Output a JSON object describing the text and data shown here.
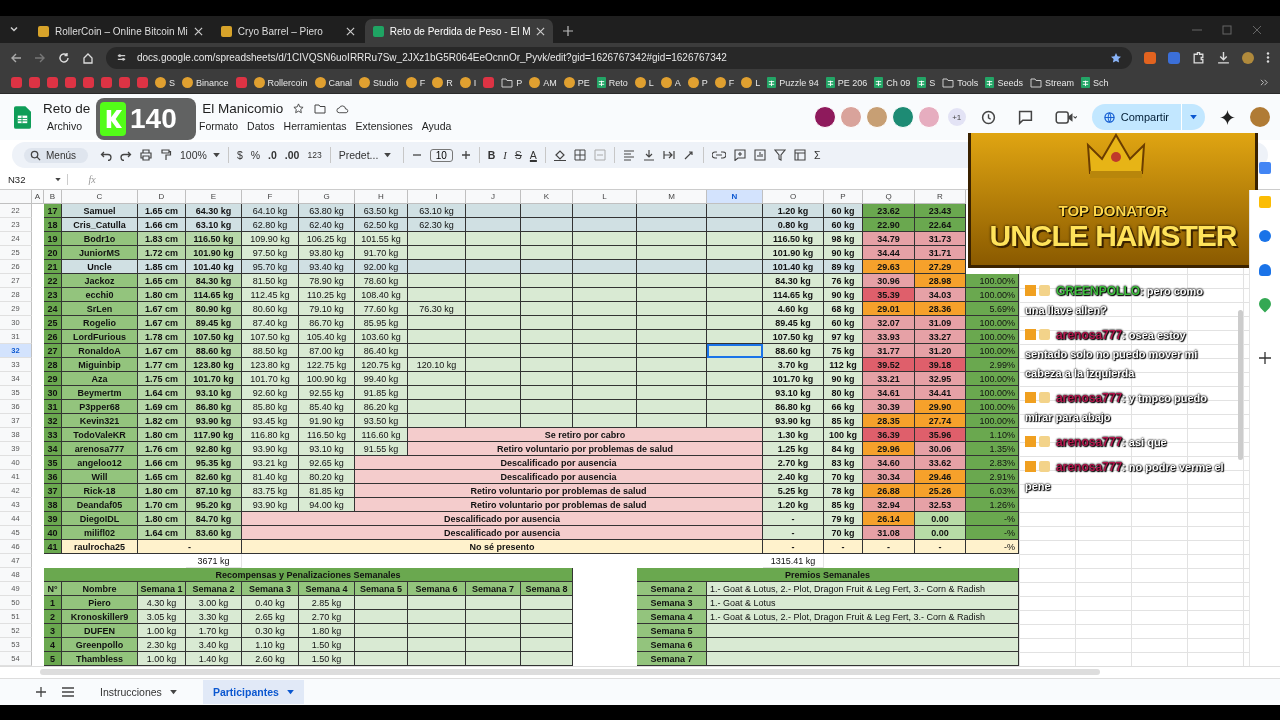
{
  "browser": {
    "tabs": [
      {
        "title": "RollerCoin – Online Bitcoin Mi",
        "selected": false
      },
      {
        "title": "Cryo Barrel – Piero",
        "selected": false
      },
      {
        "title": "Reto de Perdida de Peso - El M",
        "selected": true
      }
    ],
    "url": "docs.google.com/spreadsheets/d/1CIVQSN6uoIRRRu7Sw_2JXz1bG5R064EeOcnnOr_Pyvk/edit?gid=1626767342#gid=1626767342",
    "bookmarks": [
      {
        "kind": "icon"
      },
      {
        "kind": "icon"
      },
      {
        "kind": "icon"
      },
      {
        "kind": "icon"
      },
      {
        "kind": "icon"
      },
      {
        "kind": "icon"
      },
      {
        "kind": "icon"
      },
      {
        "kind": "icon"
      },
      {
        "kind": "site",
        "label": "S"
      },
      {
        "kind": "site",
        "label": "Binance"
      },
      {
        "kind": "icon"
      },
      {
        "kind": "site",
        "label": "Rollercoin"
      },
      {
        "kind": "site",
        "label": "Canal"
      },
      {
        "kind": "site",
        "label": "Studio"
      },
      {
        "kind": "site",
        "label": "F"
      },
      {
        "kind": "site",
        "label": "R"
      },
      {
        "kind": "site",
        "label": "I"
      },
      {
        "kind": "icon"
      },
      {
        "kind": "folder",
        "label": "P"
      },
      {
        "kind": "site",
        "label": "AM"
      },
      {
        "kind": "site",
        "label": "PE"
      },
      {
        "kind": "sheet",
        "label": "Reto"
      },
      {
        "kind": "site",
        "label": "L"
      },
      {
        "kind": "site",
        "label": "A"
      },
      {
        "kind": "site",
        "label": "P"
      },
      {
        "kind": "site",
        "label": "F"
      },
      {
        "kind": "site",
        "label": "L"
      },
      {
        "kind": "sheet",
        "label": "Puzzle 94"
      },
      {
        "kind": "sheet",
        "label": "PE 206"
      },
      {
        "kind": "sheet",
        "label": "Ch 09"
      },
      {
        "kind": "sheet",
        "label": "S"
      },
      {
        "kind": "folder",
        "label": "Tools"
      },
      {
        "kind": "sheet",
        "label": "Seeds"
      },
      {
        "kind": "folder",
        "label": "Stream"
      },
      {
        "kind": "sheet",
        "label": "Sch"
      }
    ]
  },
  "doc": {
    "title_parts": [
      "Reto de",
      "El Manicomio"
    ],
    "menus": [
      "Archivo",
      "Formato",
      "Datos",
      "Herramientas",
      "Extensiones",
      "Ayuda"
    ],
    "collaborators": [
      {
        "color": "#8e1a5c"
      },
      {
        "color": "#d9a39b"
      },
      {
        "color": "#c79f74"
      },
      {
        "color": "#1d8b74"
      },
      {
        "color": "#e6adbf"
      }
    ],
    "more_collaborators": "+1",
    "share": "Compartir"
  },
  "overlay_badge": {
    "count": "140"
  },
  "toolbar": {
    "search": "Menús",
    "zoom": "100%",
    "number_formats": [
      "$",
      "%",
      ".0",
      ".00",
      "123"
    ],
    "font": "Predet...",
    "font_size": "10",
    "styles": [
      {
        "label": "B",
        "kind": "bold"
      },
      {
        "label": "I",
        "kind": "italic"
      },
      {
        "label": "S",
        "kind": "strike"
      },
      {
        "label": "A",
        "kind": "color"
      }
    ],
    "functions": "Σ"
  },
  "formula_bar": {
    "cell": "N32",
    "label": "fx"
  },
  "sheet": {
    "columns": [
      {
        "label": "A",
        "selected": false
      },
      {
        "label": "B",
        "selected": false
      },
      {
        "label": "C",
        "selected": false
      },
      {
        "label": "D",
        "selected": false
      },
      {
        "label": "E",
        "selected": false
      },
      {
        "label": "F",
        "selected": false
      },
      {
        "label": "G",
        "selected": false
      },
      {
        "label": "H",
        "selected": false
      },
      {
        "label": "I",
        "selected": false
      },
      {
        "label": "J",
        "selected": false
      },
      {
        "label": "K",
        "selected": false
      },
      {
        "label": "L",
        "selected": false
      },
      {
        "label": "M",
        "selected": false
      },
      {
        "label": "N",
        "selected": true
      },
      {
        "label": "O",
        "selected": false
      },
      {
        "label": "P",
        "selected": false
      },
      {
        "label": "Q",
        "selected": false
      },
      {
        "label": "R",
        "selected": false
      }
    ],
    "rows": [
      {
        "row": "22",
        "selected": false,
        "kind": "highlight",
        "n": "17",
        "name": "Samuel",
        "height": "1.65 cm",
        "initial": "64.30 kg",
        "weights": [
          "64.10 kg",
          "63.80 kg",
          "63.50 kg",
          "63.10 kg"
        ],
        "loss": "1.20 kg",
        "target": "60 kg",
        "q": {
          "value": "23.62",
          "color": "#6aa84f"
        },
        "r": {
          "value": "23.43",
          "color": "#6aa84f"
        }
      },
      {
        "row": "23",
        "selected": false,
        "kind": "highlight",
        "n": "18",
        "name": "Cris_Catulla",
        "height": "1.66 cm",
        "initial": "63.10 kg",
        "weights": [
          "62.80 kg",
          "62.40 kg",
          "62.50 kg",
          "62.30 kg"
        ],
        "loss": "0.80 kg",
        "target": "60 kg",
        "q": {
          "value": "22.90",
          "color": "#6aa84f"
        },
        "r": {
          "value": "22.64",
          "color": "#6aa84f"
        }
      },
      {
        "row": "24",
        "selected": false,
        "kind": "normal",
        "n": "19",
        "name": "Bodr1o",
        "height": "1.83 cm",
        "initial": "116.50 kg",
        "weights": [
          "109.90 kg",
          "106.25 kg",
          "101.55 kg"
        ],
        "loss": "116.50 kg",
        "target": "98 kg",
        "q": {
          "value": "34.79",
          "color": "#e6a1a6"
        },
        "r": {
          "value": "31.73",
          "color": "#e6a1a6"
        }
      },
      {
        "row": "25",
        "selected": false,
        "kind": "normal",
        "n": "20",
        "name": "JuniorMS",
        "height": "1.72 cm",
        "initial": "101.90 kg",
        "weights": [
          "97.50 kg",
          "93.80 kg",
          "91.70 kg"
        ],
        "loss": "101.90 kg",
        "target": "90 kg",
        "q": {
          "value": "34.44",
          "color": "#e6a1a6"
        },
        "r": {
          "value": "31.71",
          "color": "#e6a1a6"
        }
      },
      {
        "row": "26",
        "selected": false,
        "kind": "highlight",
        "n": "21",
        "name": "Uncle",
        "height": "1.85 cm",
        "initial": "101.40 kg",
        "weights": [
          "95.70 kg",
          "93.40 kg",
          "92.00 kg"
        ],
        "loss": "101.40 kg",
        "target": "89 kg",
        "q": {
          "value": "29.63",
          "color": "#f6a12b"
        },
        "r": {
          "value": "27.29",
          "color": "#f6a12b"
        }
      },
      {
        "row": "27",
        "selected": false,
        "kind": "normal",
        "n": "22",
        "name": "Jackoz",
        "height": "1.65 cm",
        "initial": "84.30 kg",
        "weights": [
          "81.50 kg",
          "78.90 kg",
          "78.60 kg"
        ],
        "loss": "84.30 kg",
        "target": "76 kg",
        "q": {
          "value": "30.96",
          "color": "#e6a1a6"
        },
        "r": {
          "value": "28.98",
          "color": "#f6a12b"
        },
        "pct": "100.00%"
      },
      {
        "row": "28",
        "selected": false,
        "kind": "normal",
        "n": "23",
        "name": "ecchi0",
        "height": "1.80 cm",
        "initial": "114.65 kg",
        "weights": [
          "112.45 kg",
          "110.25 kg",
          "108.40 kg"
        ],
        "loss": "114.65 kg",
        "target": "90 kg",
        "q": {
          "value": "35.39",
          "color": "#df5f6b"
        },
        "r": {
          "value": "34.03",
          "color": "#e6a1a6"
        },
        "pct": "100.00%"
      },
      {
        "row": "29",
        "selected": false,
        "kind": "normal",
        "n": "24",
        "name": "SrLen",
        "height": "1.67 cm",
        "initial": "80.90 kg",
        "weights": [
          "80.60 kg",
          "79.10 kg",
          "77.60 kg",
          "76.30 kg"
        ],
        "loss": "4.60 kg",
        "target": "68 kg",
        "q": {
          "value": "29.01",
          "color": "#f6a12b"
        },
        "r": {
          "value": "28.36",
          "color": "#f6a12b"
        },
        "pct": "5.69%"
      },
      {
        "row": "30",
        "selected": false,
        "kind": "normal",
        "n": "25",
        "name": "Rogelio",
        "height": "1.67 cm",
        "initial": "89.45 kg",
        "weights": [
          "87.40 kg",
          "86.70 kg",
          "85.95 kg"
        ],
        "loss": "89.45 kg",
        "target": "60 kg",
        "q": {
          "value": "32.07",
          "color": "#e6a1a6"
        },
        "r": {
          "value": "31.09",
          "color": "#e6a1a6"
        },
        "pct": "100.00%"
      },
      {
        "row": "31",
        "selected": false,
        "kind": "normal",
        "n": "26",
        "name": "LordFurious",
        "height": "1.78 cm",
        "initial": "107.50 kg",
        "weights": [
          "107.50 kg",
          "105.40 kg",
          "103.60 kg"
        ],
        "loss": "107.50 kg",
        "target": "97 kg",
        "q": {
          "value": "33.93",
          "color": "#e6a1a6"
        },
        "r": {
          "value": "33.27",
          "color": "#e6a1a6"
        },
        "pct": "100.00%"
      },
      {
        "row": "32",
        "selected": true,
        "kind": "normal",
        "n": "27",
        "name": "RonaldoA",
        "height": "1.67 cm",
        "initial": "88.60 kg",
        "weights": [
          "88.50 kg",
          "87.00 kg",
          "86.40 kg"
        ],
        "loss": "88.60 kg",
        "target": "75 kg",
        "q": {
          "value": "31.77",
          "color": "#e6a1a6"
        },
        "r": {
          "value": "31.20",
          "color": "#e6a1a6"
        },
        "pct": "100.00%"
      },
      {
        "row": "33",
        "selected": false,
        "kind": "normal",
        "n": "28",
        "name": "Miguinbip",
        "height": "1.77 cm",
        "initial": "123.80 kg",
        "weights": [
          "123.80 kg",
          "122.75 kg",
          "120.75 kg",
          "120.10 kg"
        ],
        "loss": "3.70 kg",
        "target": "112 kg",
        "q": {
          "value": "39.52",
          "color": "#df5f6b"
        },
        "r": {
          "value": "39.18",
          "color": "#df5f6b"
        },
        "pct": "2.99%"
      },
      {
        "row": "34",
        "selected": false,
        "kind": "normal",
        "n": "29",
        "name": "Aza",
        "height": "1.75 cm",
        "initial": "101.70 kg",
        "weights": [
          "101.70 kg",
          "100.90 kg",
          "99.40 kg"
        ],
        "loss": "101.70 kg",
        "target": "90 kg",
        "q": {
          "value": "33.21",
          "color": "#e6a1a6"
        },
        "r": {
          "value": "32.95",
          "color": "#e6a1a6"
        },
        "pct": "100.00%"
      },
      {
        "row": "35",
        "selected": false,
        "kind": "normal",
        "n": "30",
        "name": "Beymertm",
        "height": "1.64 cm",
        "initial": "93.10 kg",
        "weights": [
          "92.60 kg",
          "92.55 kg",
          "91.85 kg"
        ],
        "loss": "93.10 kg",
        "target": "80 kg",
        "q": {
          "value": "34.61",
          "color": "#e6a1a6"
        },
        "r": {
          "value": "34.41",
          "color": "#e6a1a6"
        },
        "pct": "100.00%"
      },
      {
        "row": "36",
        "selected": false,
        "kind": "normal",
        "n": "31",
        "name": "P3pper68",
        "height": "1.69 cm",
        "initial": "86.80 kg",
        "weights": [
          "85.80 kg",
          "85.40 kg",
          "86.20 kg"
        ],
        "loss": "86.80 kg",
        "target": "66 kg",
        "q": {
          "value": "30.39",
          "color": "#e6a1a6"
        },
        "r": {
          "value": "29.90",
          "color": "#f6a12b"
        },
        "pct": "100.00%"
      },
      {
        "row": "37",
        "selected": false,
        "kind": "normal",
        "n": "32",
        "name": "Kevin321",
        "height": "1.82 cm",
        "initial": "93.90 kg",
        "weights": [
          "93.45 kg",
          "91.90 kg",
          "93.50 kg"
        ],
        "loss": "93.90 kg",
        "target": "85 kg",
        "q": {
          "value": "28.35",
          "color": "#f6a12b"
        },
        "r": {
          "value": "27.74",
          "color": "#f6a12b"
        },
        "pct": "100.00%"
      },
      {
        "row": "38",
        "selected": false,
        "kind": "normal",
        "n": "33",
        "name": "TodoValeKR",
        "height": "1.80 cm",
        "initial": "117.90 kg",
        "weights": [
          "116.80 kg",
          "116.50 kg",
          "116.60 kg"
        ],
        "status": "Se retiro por cabro",
        "loss": "1.30 kg",
        "target": "100 kg",
        "q": {
          "value": "36.39",
          "color": "#df5f6b"
        },
        "r": {
          "value": "35.96",
          "color": "#df5f6b"
        },
        "pct": "1.10%"
      },
      {
        "row": "39",
        "selected": false,
        "kind": "normal",
        "n": "34",
        "name": "arenosa777",
        "height": "1.76 cm",
        "initial": "92.80 kg",
        "weights": [
          "93.90 kg",
          "93.10 kg",
          "91.55 kg"
        ],
        "status": "Retiro voluntario por problemas de salud",
        "loss": "1.25 kg",
        "target": "84 kg",
        "q": {
          "value": "29.96",
          "color": "#f6a12b"
        },
        "r": {
          "value": "30.06",
          "color": "#e6a1a6"
        },
        "pct": "1.35%"
      },
      {
        "row": "40",
        "selected": false,
        "kind": "normal",
        "n": "35",
        "name": "angeloo12",
        "height": "1.66 cm",
        "initial": "95.35 kg",
        "weights": [
          "93.21 kg",
          "92.65 kg"
        ],
        "status": "Descalificado por ausencia",
        "loss": "2.70 kg",
        "target": "83 kg",
        "q": {
          "value": "34.60",
          "color": "#e6a1a6"
        },
        "r": {
          "value": "33.62",
          "color": "#e6a1a6"
        },
        "pct": "2.83%"
      },
      {
        "row": "41",
        "selected": false,
        "kind": "normal",
        "n": "36",
        "name": "Will",
        "height": "1.65 cm",
        "initial": "82.60 kg",
        "weights": [
          "81.40 kg",
          "80.20 kg"
        ],
        "status": "Descalificado por ausencia",
        "loss": "2.40 kg",
        "target": "70 kg",
        "q": {
          "value": "30.34",
          "color": "#e6a1a6"
        },
        "r": {
          "value": "29.46",
          "color": "#f6a12b"
        },
        "pct": "2.91%"
      },
      {
        "row": "42",
        "selected": false,
        "kind": "normal",
        "n": "37",
        "name": "Rick-18",
        "height": "1.80 cm",
        "initial": "87.10 kg",
        "weights": [
          "83.75 kg",
          "81.85 kg"
        ],
        "status": "Retiro voluntario por problemas de salud",
        "loss": "5.25 kg",
        "target": "78 kg",
        "q": {
          "value": "26.88",
          "color": "#f6a12b"
        },
        "r": {
          "value": "25.26",
          "color": "#f6a12b"
        },
        "pct": "6.03%"
      },
      {
        "row": "43",
        "selected": false,
        "kind": "normal",
        "n": "38",
        "name": "Deandaf05",
        "height": "1.70 cm",
        "initial": "95.20 kg",
        "weights": [
          "93.90 kg",
          "94.00 kg"
        ],
        "status": "Retiro voluntario por problemas de salud",
        "loss": "1.20 kg",
        "target": "85 kg",
        "q": {
          "value": "32.94",
          "color": "#e6a1a6"
        },
        "r": {
          "value": "32.53",
          "color": "#e6a1a6"
        },
        "pct": "1.26%"
      },
      {
        "row": "44",
        "selected": false,
        "kind": "normal",
        "n": "39",
        "name": "DiegoIDL",
        "height": "1.80 cm",
        "initial": "84.70 kg",
        "weights": [],
        "status": "Descalificado por ausencia",
        "loss": "-",
        "target": "79 kg",
        "q": {
          "value": "26.14",
          "color": "#f6a12b"
        },
        "r": {
          "value": "0.00",
          "color": "#b7dba6"
        },
        "pct": "-%"
      },
      {
        "row": "45",
        "selected": false,
        "kind": "normal",
        "n": "40",
        "name": "milifl02",
        "height": "1.64 cm",
        "initial": "83.60 kg",
        "weights": [],
        "status": "Descalificado por ausencia",
        "loss": "-",
        "target": "70 kg",
        "q": {
          "value": "31.08",
          "color": "#e6a1a6"
        },
        "r": {
          "value": "0.00",
          "color": "#b7dba6"
        },
        "pct": "-%"
      },
      {
        "row": "46",
        "selected": false,
        "kind": "absent",
        "n": "41",
        "name": "raulrocha25",
        "height": "-",
        "weights": [],
        "status": "No sé presento",
        "loss": "-",
        "target": "-",
        "q": {
          "value": "-",
          "color": "#fff2cc"
        },
        "r": {
          "value": "-",
          "color": "#fff2cc"
        },
        "pct": "-%"
      }
    ],
    "lower_row_numbers": [
      "47",
      "48",
      "49",
      "50",
      "51",
      "52",
      "53",
      "54"
    ],
    "totals": {
      "weight": "3671 kg",
      "loss": "1315.41 kg"
    },
    "rewards": {
      "title": "Recompensas y Penalizaciones Semanales",
      "headers": [
        "N°",
        "Nombre",
        "Semana 1",
        "Semana 2",
        "Semana 3",
        "Semana 4",
        "Semana 5",
        "Semana 6",
        "Semana 7",
        "Semana 8"
      ],
      "rows": [
        {
          "n": "1",
          "name": "Piero",
          "weeks": [
            "4.30 kg",
            "3.00 kg",
            "0.40 kg",
            "2.85 kg"
          ]
        },
        {
          "n": "2",
          "name": "Kronoskiller9",
          "weeks": [
            "3.05 kg",
            "3.30 kg",
            "2.65 kg",
            "2.70 kg"
          ]
        },
        {
          "n": "3",
          "name": "DUFEN",
          "weeks": [
            "1.00 kg",
            "1.70 kg",
            "0.30 kg",
            "1.80 kg"
          ]
        },
        {
          "n": "4",
          "name": "Greenpollo",
          "weeks": [
            "2.30 kg",
            "3.40 kg",
            "1.10 kg",
            "1.50 kg"
          ]
        },
        {
          "n": "5",
          "name": "Thambless",
          "weeks": [
            "1.00 kg",
            "1.40 kg",
            "2.60 kg",
            "1.50 kg"
          ]
        }
      ]
    },
    "prizes": {
      "title": "Premios Semanales",
      "rows": [
        {
          "week": "Semana 2",
          "text": "1.- Goat & Lotus, 2.- Plot, Dragon Fruit & Leg Fert, 3.- Corn & Radish"
        },
        {
          "week": "Semana 3",
          "text": "1.- Goat & Lotus"
        },
        {
          "week": "Semana 4",
          "text": "1.- Goat & Lotus, 2.- Plot, Dragon Fruit & Leg Fert, 3.- Corn & Radish"
        },
        {
          "week": "Semana 5"
        },
        {
          "week": "Semana 6"
        },
        {
          "week": "Semana 7"
        }
      ]
    }
  },
  "sheet_tabs": [
    {
      "label": "Instrucciones",
      "selected": false
    },
    {
      "label": "Participantes",
      "selected": true
    }
  ],
  "donator": {
    "label": "TOP DONATOR",
    "name": "UNCLE HAMSTER"
  },
  "chat": [
    {
      "user": "GREENPOLLO",
      "color": "#3fbf3f",
      "text": ": pero como una llave allen?"
    },
    {
      "user": "arenosa777",
      "color": "#b3174d",
      "text": ": osea estoy sentado solo no puedo mover mi cabeza a la izquierda"
    },
    {
      "user": "arenosa777",
      "color": "#b3174d",
      "text": ": y tmpco puedo mirar para abajo"
    },
    {
      "user": "arenosa777",
      "color": "#b3174d",
      "text": ": asi que"
    },
    {
      "user": "arenosa777",
      "color": "#b3174d",
      "text": ": no podre verme el pene"
    }
  ]
}
